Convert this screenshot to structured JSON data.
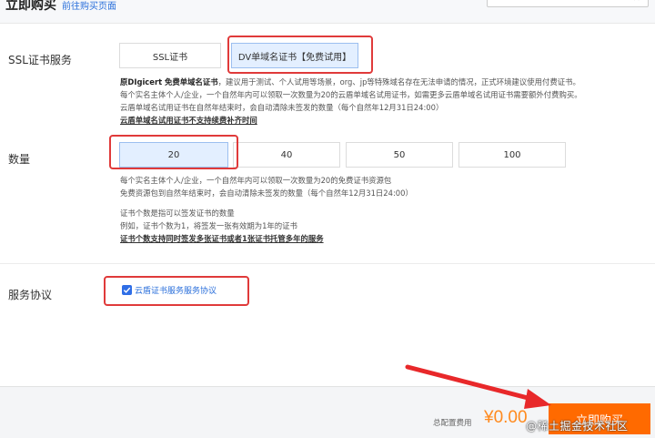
{
  "header": {
    "title": "立即购买",
    "link": "前往购买页面",
    "box_text": "✕"
  },
  "ssl": {
    "label": "SSL证书服务",
    "options": [
      "SSL证书",
      "DV单域名证书【免费试用】"
    ],
    "notes": [
      [
        "原DIgicert 免费单域名证书",
        "，建议用于测试、个人试用等场景，org、jp等特殊域名存在无法申请的情况，正式环境建议使用付费证书。"
      ],
      "每个实名主体个人/企业，一个自然年内可以领取一次数量为20的云盾单域名试用证书，如需更多云盾单域名试用证书需要额外付费购买。",
      "云盾单域名试用证书在自然年结束时，会自动清除未签发的数量（每个自然年12月31日24:00）",
      "云盾单域名试用证书不支持续费补齐时间"
    ]
  },
  "quantity": {
    "label": "数量",
    "options": [
      "20",
      "40",
      "50",
      "100"
    ],
    "notes": [
      "每个实名主体个人/企业，一个自然年内可以领取一次数量为20的免费证书资源包",
      "免费资源包到自然年结束时，会自动清除未签发的数量（每个自然年12月31日24:00）",
      "证书个数是指可以签发证书的数量",
      "例如，证书个数为1，将签发一张有效期为1年的证书",
      "证书个数支持同时签发多张证书或者1张证书托管多年的服务"
    ]
  },
  "agreement": {
    "label": "服务协议",
    "text": "云盾证书服务服务协议"
  },
  "footer": {
    "total_label": "总配置费用",
    "price": "¥0.00",
    "buy_label": "立即购买",
    "watermark": "@稀土掘金技术社区"
  },
  "colors": {
    "accent": "#2f6ee6",
    "highlight": "#e03a3a",
    "price": "#ff8a1e",
    "buy": "#ff6a00"
  }
}
